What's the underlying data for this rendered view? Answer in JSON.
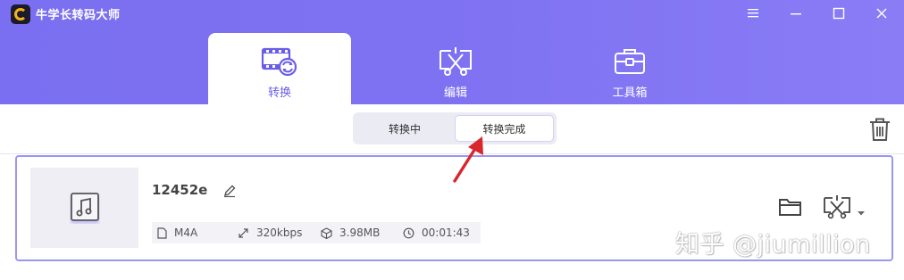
{
  "app": {
    "title": "牛学长转码大师"
  },
  "window_controls": {
    "menu_icon": "menu-icon",
    "minimize_icon": "minimize-icon",
    "maximize_icon": "maximize-icon",
    "close_icon": "close-icon"
  },
  "main_tabs": [
    {
      "label": "转换",
      "icon": "convert-icon",
      "active": true
    },
    {
      "label": "编辑",
      "icon": "scissors-edit-icon",
      "active": false
    },
    {
      "label": "工具箱",
      "icon": "toolbox-icon",
      "active": false
    }
  ],
  "sub_tabs": [
    {
      "label": "转换中",
      "active": false
    },
    {
      "label": "转换完成",
      "active": true
    }
  ],
  "file": {
    "name": "12452e",
    "format": "M4A",
    "bitrate": "320kbps",
    "size": "3.98MB",
    "duration": "00:01:43",
    "thumb_icon": "music-note-icon"
  },
  "actions": {
    "delete_icon": "trash-icon",
    "folder_icon": "folder-icon",
    "edit_icon": "scissors-edit-icon",
    "rename_icon": "pencil-icon"
  },
  "watermark": "知乎 @jiumillion",
  "colors": {
    "header_bg": "#7f72f2",
    "accent": "#6a5ee8",
    "card_border": "#9d96ee",
    "annotation_arrow": "#d9262c"
  }
}
